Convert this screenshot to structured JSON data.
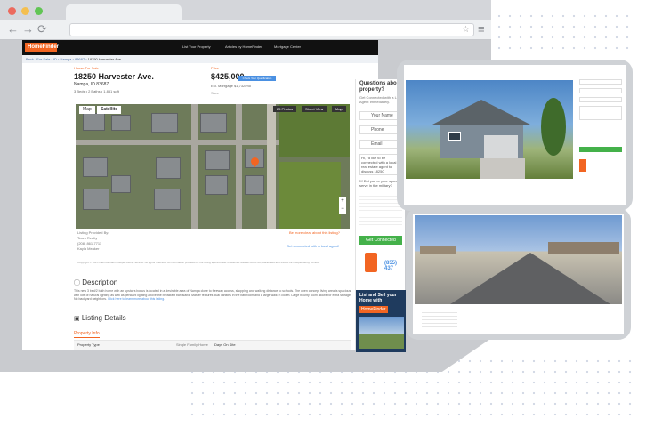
{
  "brand": {
    "accent": "#f26522",
    "link": "#4a90e2",
    "green": "#44b14a"
  },
  "header": {
    "logo": "HomeFinder",
    "nav": [
      "List Your Property",
      "Articles by HomeFinder",
      "Mortgage Center"
    ],
    "search_value": "Canyon County, ID",
    "user": "The Homer",
    "sign_in": "Sign In"
  },
  "breadcrumb": [
    "Back",
    "For Sale",
    "ID",
    "Nampa",
    "83687",
    "18250 Harvester Ave."
  ],
  "listing": {
    "tag": "House For Sale",
    "address": "18250 Harvester Ave.",
    "city": "Nampa, ID 83687",
    "specs": "3 Beds • 2 Baths • 1,851 sqft",
    "save": "Save",
    "price_tag": "Price",
    "price": "$425,000",
    "price_button": "Check Your Qualification",
    "mortgage": "Est. Mortgage $1,732/mo",
    "map_tabs": [
      "Map",
      "Satellite"
    ],
    "map_buttons": [
      "25 Photos",
      "Street View",
      "Map"
    ],
    "provider_label": "Listing Provided By:",
    "provider_name": "Team Realty",
    "provider_phone": "(208) 861-7711",
    "provider_agent": "Kayla Meaker",
    "report": "Be more clear about this listing?",
    "connect": "Get connected with a local agent!",
    "copyright": "Copyright © 2025 Intermountain Multiple Listing Service. All rights reserved. All information provided by the listing agent/broker is deemed reliable but is not guaranteed and should be independently verified.",
    "desc_title": "Description",
    "desc_text": "This new 3 bed/2 bath home with an upstairs bonus is located in a desirable area of Nampa close to freeway access, shopping and walking distance to schools. The open concept living area is spacious with lots of natural lighting as well as pendant lighting above the breakfast bar/island. Master features dual vanities in the bathroom and a large walk in closet. Large bounty room allows for extra storage. No backyard neighbors.",
    "desc_link": "Click here to learn more about this listing.",
    "details_title": "Listing Details",
    "property_info": "Property Info",
    "prop_type_label": "Property Type",
    "prop_type_value": "Single Family Home",
    "days_label": "Days On Site"
  },
  "sidebar": {
    "question": "Questions about this property?",
    "sub": "Get Connected with a Local Agent Immediately.",
    "fields": [
      "Your Name",
      "Phone",
      "Email"
    ],
    "message": "Hi, I'd like to be connected with a local real estate agent to discuss 18250 Harvester Ave.",
    "military": "Did you or your spouse serve in the military?",
    "contact_btn": "Get Connected",
    "phone": "(855) 437"
  },
  "ad": {
    "title": "List and Sell your Home with",
    "brand": "HomeFinder"
  }
}
